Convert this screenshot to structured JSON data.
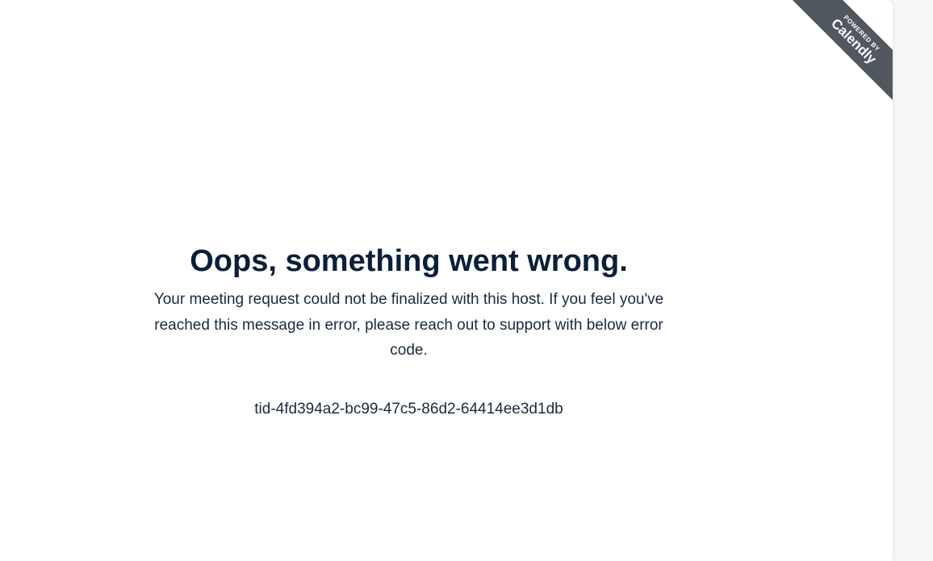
{
  "badge": {
    "powered_by": "POWERED BY",
    "brand": "Calendly"
  },
  "error": {
    "title": "Oops, something went wrong.",
    "message": "Your meeting request could not be finalized with this host. If you feel you've reached this message in error, please reach out to support with below error code.",
    "code": "tid-4fd394a2-bc99-47c5-86d2-64414ee3d1db"
  }
}
